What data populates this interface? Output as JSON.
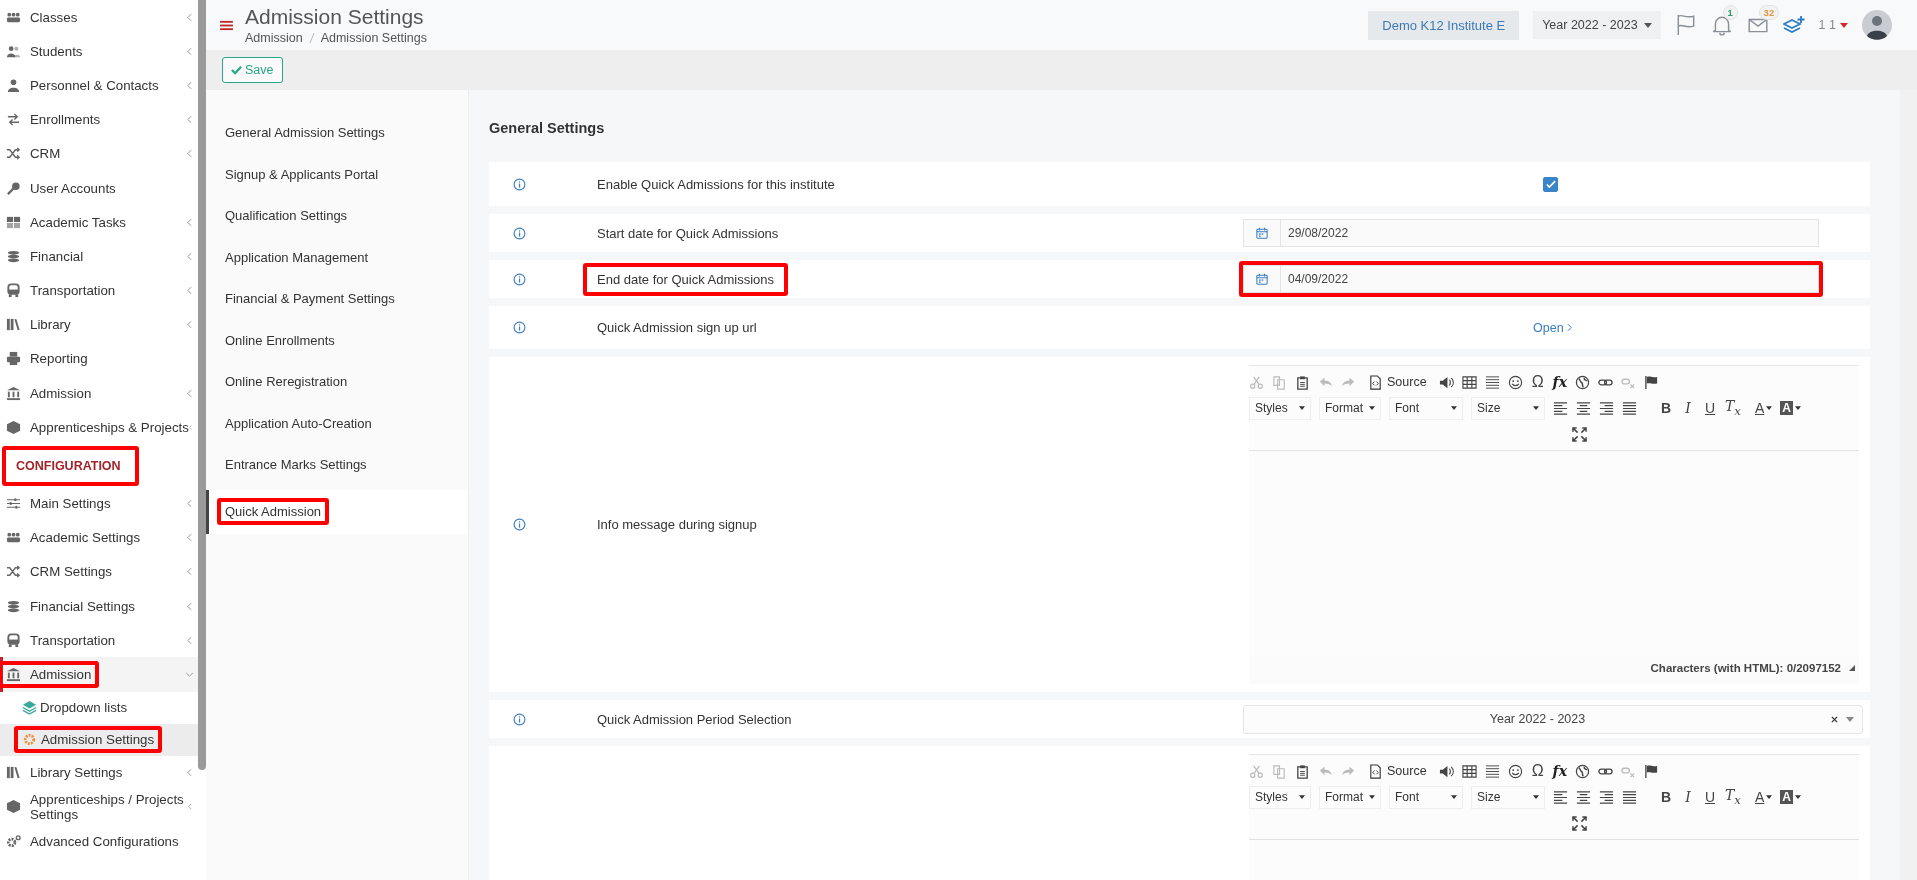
{
  "sidebar": {
    "items": [
      {
        "label": "Classes",
        "expanded": false
      },
      {
        "label": "Students",
        "expanded": false
      },
      {
        "label": "Personnel & Contacts",
        "expanded": false
      },
      {
        "label": "Enrollments",
        "expanded": false
      },
      {
        "label": "CRM",
        "expanded": false
      },
      {
        "label": "User Accounts"
      },
      {
        "label": "Academic Tasks",
        "expanded": false
      },
      {
        "label": "Financial",
        "expanded": false
      },
      {
        "label": "Transportation",
        "expanded": false
      },
      {
        "label": "Library",
        "expanded": false
      },
      {
        "label": "Reporting"
      },
      {
        "label": "Admission",
        "expanded": false
      },
      {
        "label": "Apprenticeships & Projects",
        "expanded": false
      }
    ],
    "section_title": "CONFIGURATION",
    "section_highlighted": true,
    "config_items": [
      {
        "label": "Main Settings",
        "expanded": false,
        "selected": false,
        "highlighted": false
      },
      {
        "label": "Academic Settings",
        "expanded": false,
        "selected": false,
        "highlighted": false
      },
      {
        "label": "CRM Settings",
        "expanded": false,
        "selected": false,
        "highlighted": false
      },
      {
        "label": "Financial Settings",
        "expanded": false,
        "selected": false,
        "highlighted": false
      },
      {
        "label": "Transportation",
        "expanded": false,
        "selected": false,
        "highlighted": false
      },
      {
        "label": "Admission",
        "expanded": true,
        "selected": true,
        "highlighted": true,
        "children": [
          {
            "label": "Dropdown lists",
            "selected": false,
            "highlighted": false
          },
          {
            "label": "Admission Settings",
            "selected": true,
            "highlighted": true
          }
        ]
      },
      {
        "label": "Library Settings",
        "expanded": false,
        "selected": false,
        "highlighted": false
      },
      {
        "label": "Apprenticeships / Projects Settings",
        "expanded": false,
        "selected": false,
        "highlighted": false
      },
      {
        "label": "Advanced Configurations",
        "selected": false,
        "highlighted": false
      }
    ]
  },
  "header": {
    "title": "Admission Settings",
    "breadcrumb": [
      "Admission",
      "Admission Settings"
    ],
    "institute": "Demo K12 Institute E",
    "year": "Year 2022 - 2023",
    "notifications_count": "1",
    "messages_count": "32",
    "user": "1 1"
  },
  "toolbar": {
    "save_label": "Save"
  },
  "settings_nav": [
    {
      "label": "General Admission Settings",
      "selected": false,
      "highlighted": false
    },
    {
      "label": "Signup & Applicants Portal",
      "selected": false,
      "highlighted": false
    },
    {
      "label": "Qualification Settings",
      "selected": false,
      "highlighted": false
    },
    {
      "label": "Application Management",
      "selected": false,
      "highlighted": false
    },
    {
      "label": "Financial & Payment Settings",
      "selected": false,
      "highlighted": false
    },
    {
      "label": "Online Enrollments",
      "selected": false,
      "highlighted": false
    },
    {
      "label": "Online Reregistration",
      "selected": false,
      "highlighted": false
    },
    {
      "label": "Application Auto-Creation",
      "selected": false,
      "highlighted": false
    },
    {
      "label": "Entrance Marks Settings",
      "selected": false,
      "highlighted": false
    },
    {
      "label": "Quick Admission",
      "selected": true,
      "highlighted": true
    }
  ],
  "section_heading": "General Settings",
  "settings": [
    {
      "kind": "checkbox",
      "label": "Enable Quick Admissions for this institute",
      "checked": true,
      "highlighted": false
    },
    {
      "kind": "date",
      "label": "Start date for Quick Admissions",
      "value": "29/08/2022",
      "highlighted": false,
      "field_highlighted": false
    },
    {
      "kind": "date",
      "label": "End date for Quick Admissions",
      "value": "04/09/2022",
      "highlighted": true,
      "field_highlighted": true
    },
    {
      "kind": "link",
      "label": "Quick Admission sign up url",
      "link": "Open",
      "highlighted": false
    },
    {
      "kind": "editor",
      "label": "Info message during signup",
      "highlighted": false,
      "toolbar": {
        "source": "Source",
        "special_char": "Ω",
        "formula": "fx",
        "dropdowns": [
          "Styles",
          "Format",
          "Font",
          "Size"
        ],
        "bold": "B",
        "italic": "I",
        "underline": "U",
        "remove_format": "T$_{x}$",
        "text_color": "A",
        "background_color": "A"
      },
      "counter": "Characters (with HTML): 0/2097152"
    },
    {
      "kind": "select",
      "label": "Quick Admission Period Selection",
      "value": "Year 2022 - 2023",
      "highlighted": false
    },
    {
      "kind": "editor",
      "highlighted": false,
      "toolbar": {
        "source": "Source",
        "special_char": "Ω",
        "formula": "fx",
        "dropdowns": [
          "Styles",
          "Format",
          "Font",
          "Size"
        ],
        "bold": "B",
        "italic": "I",
        "underline": "U",
        "remove_format": "T$_{x}$",
        "text_color": "A",
        "background_color": "A"
      }
    }
  ]
}
